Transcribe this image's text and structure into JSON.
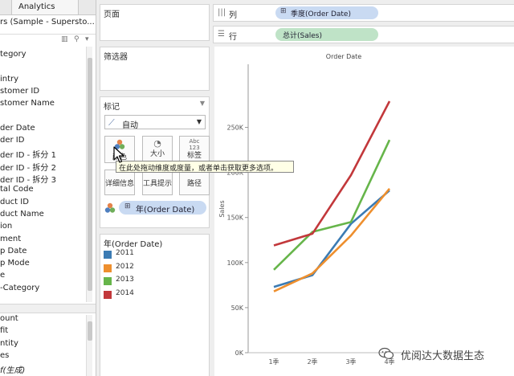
{
  "data_pane": {
    "tab_label": "Analytics",
    "datasource": "rs (Sample - Supersto...",
    "tools": [
      "▥",
      "⚲",
      "▾"
    ],
    "dimensions": [
      "tegory",
      "",
      "intry",
      "stomer ID",
      "stomer Name",
      "",
      "der Date",
      "der ID",
      "der ID - 拆分 1",
      "der ID - 拆分 2",
      "der ID - 拆分 3",
      "tal Code",
      "duct ID",
      "duct Name",
      "ion",
      "ment",
      "p Date",
      "p Mode",
      "e",
      "-Category"
    ],
    "measures": [
      "ount",
      "fit",
      "ntity",
      "es",
      "f(生成)"
    ]
  },
  "cards": {
    "pages_title": "页面",
    "filters_title": "筛选器",
    "marks_title": "标记",
    "marks_menu": "▼",
    "mark_type": "自动",
    "mark_type_icon": "⟋",
    "mark_type_caret": "▼",
    "buttons": {
      "color": "颜色",
      "size": "大小",
      "label": "标签",
      "detail": "详细信息",
      "tooltip": "工具提示",
      "path": "路径",
      "size_icon": "◔",
      "label_icon": "Abc 123"
    },
    "mark_pill": "年(Order Date)",
    "mark_pill_plus": "⊞"
  },
  "tooltip": "在此处拖动维度或度量，或者单击获取更多选项。",
  "legend": {
    "title": "年(Order Date)",
    "items": [
      {
        "label": "2011",
        "color": "#3b7bb3"
      },
      {
        "label": "2012",
        "color": "#ee8f2e"
      },
      {
        "label": "2013",
        "color": "#66b54a"
      },
      {
        "label": "2014",
        "color": "#c2383b"
      }
    ]
  },
  "shelves": {
    "columns_label": "列",
    "columns_icon": "|||",
    "columns_pill": "季度(Order Date)",
    "rows_label": "行",
    "rows_icon": "☰",
    "rows_pill": "总计(Sales)",
    "pill_plus": "⊞"
  },
  "chart_data": {
    "type": "line",
    "title": "Order Date",
    "ylabel": "Sales",
    "xlabel": "",
    "categories": [
      "1季",
      "2季",
      "3季",
      "4季"
    ],
    "ylim": [
      0,
      320000
    ],
    "yticks": [
      0,
      50000,
      100000,
      150000,
      200000,
      250000
    ],
    "ytick_labels": [
      "0K",
      "50K",
      "100K",
      "150K",
      "200K",
      "250K"
    ],
    "grid": false,
    "legend": "left-panel",
    "series": [
      {
        "name": "2011",
        "color": "#3b7bb3",
        "values": [
          73000,
          86000,
          143000,
          180000
        ]
      },
      {
        "name": "2012",
        "color": "#ee8f2e",
        "values": [
          68000,
          88000,
          130000,
          182000
        ]
      },
      {
        "name": "2013",
        "color": "#66b54a",
        "values": [
          92000,
          134000,
          145000,
          236000
        ]
      },
      {
        "name": "2014",
        "color": "#c2383b",
        "values": [
          119000,
          132000,
          197000,
          279000
        ]
      }
    ]
  },
  "watermark": "优阅达大数据生态"
}
